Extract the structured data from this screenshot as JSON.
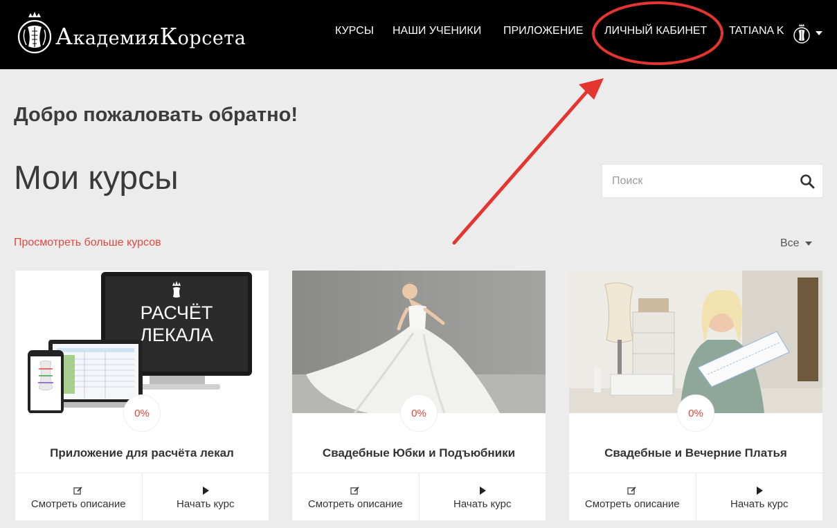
{
  "header": {
    "logo_text_prefix_big": "А",
    "logo_text_prefix": "кадемия",
    "logo_text_suffix_big": "К",
    "logo_text_suffix": "орсета",
    "nav": [
      {
        "label": "КУРСЫ"
      },
      {
        "label": "НАШИ УЧЕНИКИ"
      },
      {
        "label": "ПРИЛОЖЕНИЕ"
      },
      {
        "label": "ЛИЧНЫЙ КАБИНЕТ"
      },
      {
        "label": "TATIANA K"
      }
    ],
    "avatar_icon": "corset-crown-icon"
  },
  "annotation": {
    "color": "#e53530",
    "shapes": [
      "ellipse-around-personal-account",
      "arrow-pointing-to-personal-account"
    ]
  },
  "main": {
    "welcome": "Добро пожаловать обратно!",
    "title": "Мои курсы",
    "search": {
      "placeholder": "Поиск",
      "value": ""
    },
    "more_courses_link": "Просмотреть больше курсов",
    "filter": {
      "selected": "Все"
    }
  },
  "courses": [
    {
      "title": "Приложение для расчёта лекал",
      "progress": "0%",
      "image_text_line1": "РАСЧЁТ",
      "image_text_line2": "ЛЕКАЛА",
      "description_label": "Смотреть описание",
      "start_label": "Начать курс"
    },
    {
      "title": "Свадебные Юбки и Подъюбники",
      "progress": "0%",
      "description_label": "Смотреть описание",
      "start_label": "Начать курс"
    },
    {
      "title": "Свадебные и Вечерние Платья",
      "progress": "0%",
      "description_label": "Смотреть описание",
      "start_label": "Начать курс"
    }
  ],
  "colors": {
    "accent": "#e0483e",
    "header_bg": "#000000",
    "page_bg": "#ececec"
  }
}
